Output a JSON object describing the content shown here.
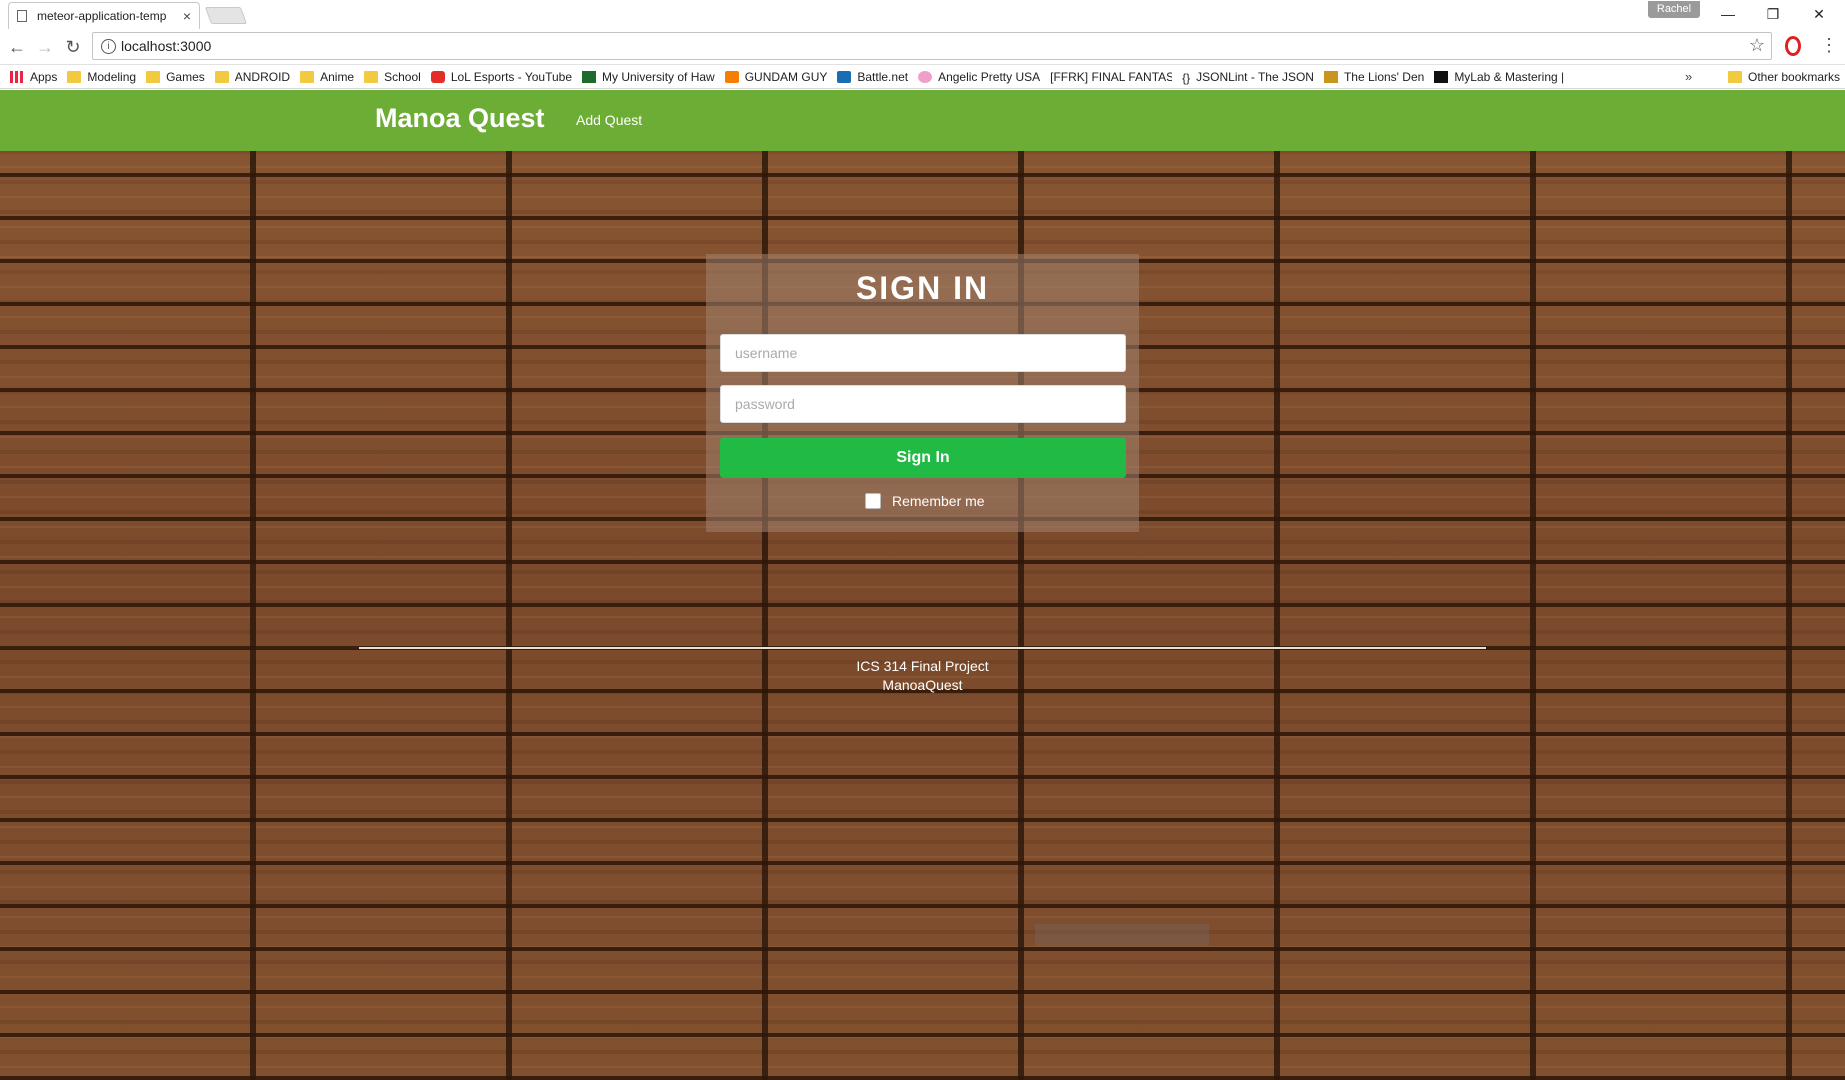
{
  "browser": {
    "tab_title": "meteor-application-temp",
    "tab_close": "×",
    "profile_name": "Rachel",
    "url": "localhost:3000",
    "window_controls": {
      "minimize": "—",
      "restore": "❐",
      "close": "✕"
    },
    "nav_icons": {
      "back": "←",
      "forward": "→",
      "reload": "↻",
      "info": "i",
      "star": "☆",
      "menu": "⋮"
    },
    "bookmarks": [
      {
        "label": "Apps",
        "icon": "apps-icon"
      },
      {
        "label": "Modeling",
        "icon": "folder-icon"
      },
      {
        "label": "Games",
        "icon": "folder-icon"
      },
      {
        "label": "ANDROID",
        "icon": "folder-icon"
      },
      {
        "label": "Anime",
        "icon": "folder-icon"
      },
      {
        "label": "School",
        "icon": "folder-icon"
      },
      {
        "label": "LoL Esports - YouTube",
        "icon": "youtube-icon"
      },
      {
        "label": "My University of Haw",
        "icon": "uh-icon"
      },
      {
        "label": "GUNDAM GUY",
        "icon": "blogger-icon"
      },
      {
        "label": "Battle.net",
        "icon": "battlenet-icon"
      },
      {
        "label": "Angelic Pretty USA",
        "icon": "angelic-icon"
      },
      {
        "label": "[FFRK] FINAL FANTAS",
        "icon": "page-icon"
      },
      {
        "label": "JSONLint - The JSON",
        "icon": "json-icon"
      },
      {
        "label": "The Lions' Den",
        "icon": "lions-icon"
      },
      {
        "label": "MyLab & Mastering |",
        "icon": "mylab-icon"
      }
    ],
    "overflow": "»",
    "other_bookmarks": "Other bookmarks"
  },
  "navbar": {
    "brand": "Manoa Quest",
    "links": [
      "Add Quest"
    ],
    "color": "#6cad35"
  },
  "signin": {
    "title": "SIGN IN",
    "username_placeholder": "username",
    "password_placeholder": "password",
    "button_label": "Sign In",
    "button_color": "#21ba45",
    "remember_label": "Remember me",
    "remember_checked": false
  },
  "footer": {
    "line1": "ICS 314 Final Project",
    "line2": "ManoaQuest"
  }
}
